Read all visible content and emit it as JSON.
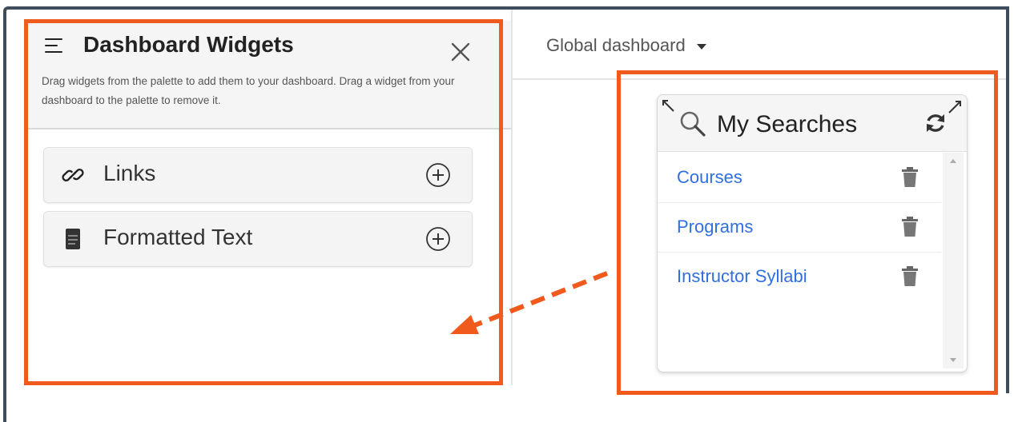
{
  "palette": {
    "title": "Dashboard Widgets",
    "help_text": "Drag widgets from the palette to add them to your dashboard. Drag a widget from your dashboard to the palette to remove it.",
    "items": [
      {
        "label": "Links",
        "icon": "link-icon"
      },
      {
        "label": "Formatted Text",
        "icon": "document-icon"
      }
    ]
  },
  "dashboard": {
    "selector_label": "Global dashboard"
  },
  "widget": {
    "title": "My Searches",
    "icon": "search-icon",
    "searches": [
      {
        "label": "Courses"
      },
      {
        "label": "Programs"
      },
      {
        "label": "Instructor Syllabi"
      }
    ]
  },
  "colors": {
    "annotation": "#f05a1c",
    "link": "#2f6fe0",
    "frame": "#3e4d5b"
  }
}
